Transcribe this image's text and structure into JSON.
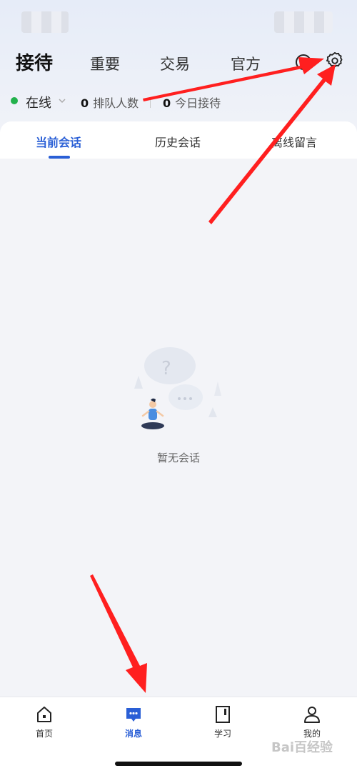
{
  "top_tabs": {
    "reception": "接待",
    "important": "重要",
    "trade": "交易",
    "official": "官方"
  },
  "status": {
    "online_label": "在线",
    "queue_count": "0",
    "queue_label": "排队人数",
    "today_count": "0",
    "today_label": "今日接待"
  },
  "conversation_tabs": {
    "current": "当前会话",
    "history": "历史会话",
    "offline": "离线留言"
  },
  "empty_state": {
    "text": "暂无会话"
  },
  "bottom_nav": {
    "home": "首页",
    "messages": "消息",
    "learn": "学习",
    "mine": "我的"
  },
  "watermark": "Bai百经验",
  "colors": {
    "accent": "#2a5fd6",
    "online": "#22b14c",
    "annotation_arrow": "#ff1f1f"
  }
}
